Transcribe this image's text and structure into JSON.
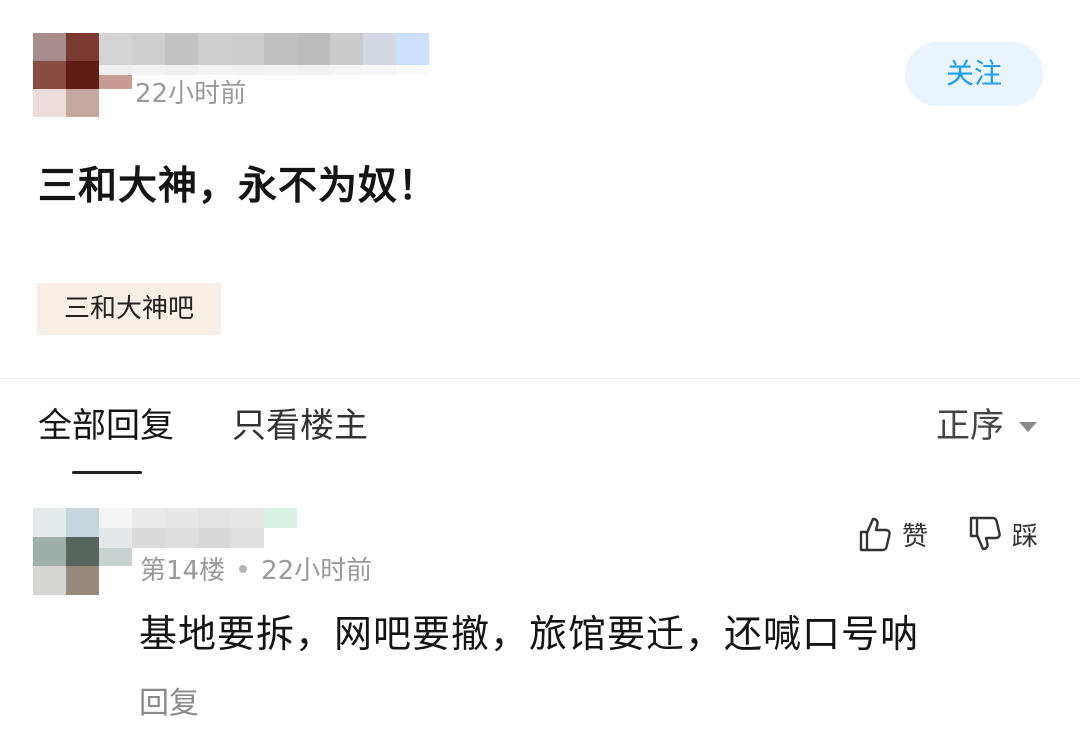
{
  "post": {
    "time": "22小时前",
    "follow_label": "关注",
    "title": "三和大神，永不为奴！",
    "tag": "三和大神吧"
  },
  "tabs": {
    "all_replies": "全部回复",
    "owner_only": "只看楼主",
    "sort": "正序"
  },
  "reply": {
    "floor": "第14楼",
    "time": "22小时前",
    "text": "基地要拆，网吧要撤，旅馆要迁，还喊口号呐",
    "reply_label": "回复",
    "like_label": "赞",
    "dislike_label": "踩"
  },
  "icons": {
    "like": "thumbs-up-icon",
    "dislike": "thumbs-down-icon",
    "sort": "caret-down-icon"
  },
  "colors": {
    "accent": "#1f9df2",
    "follow_bg": "#e9f4fc",
    "tag_bg": "#f7efe6",
    "meta_text": "#9a9a9a"
  }
}
